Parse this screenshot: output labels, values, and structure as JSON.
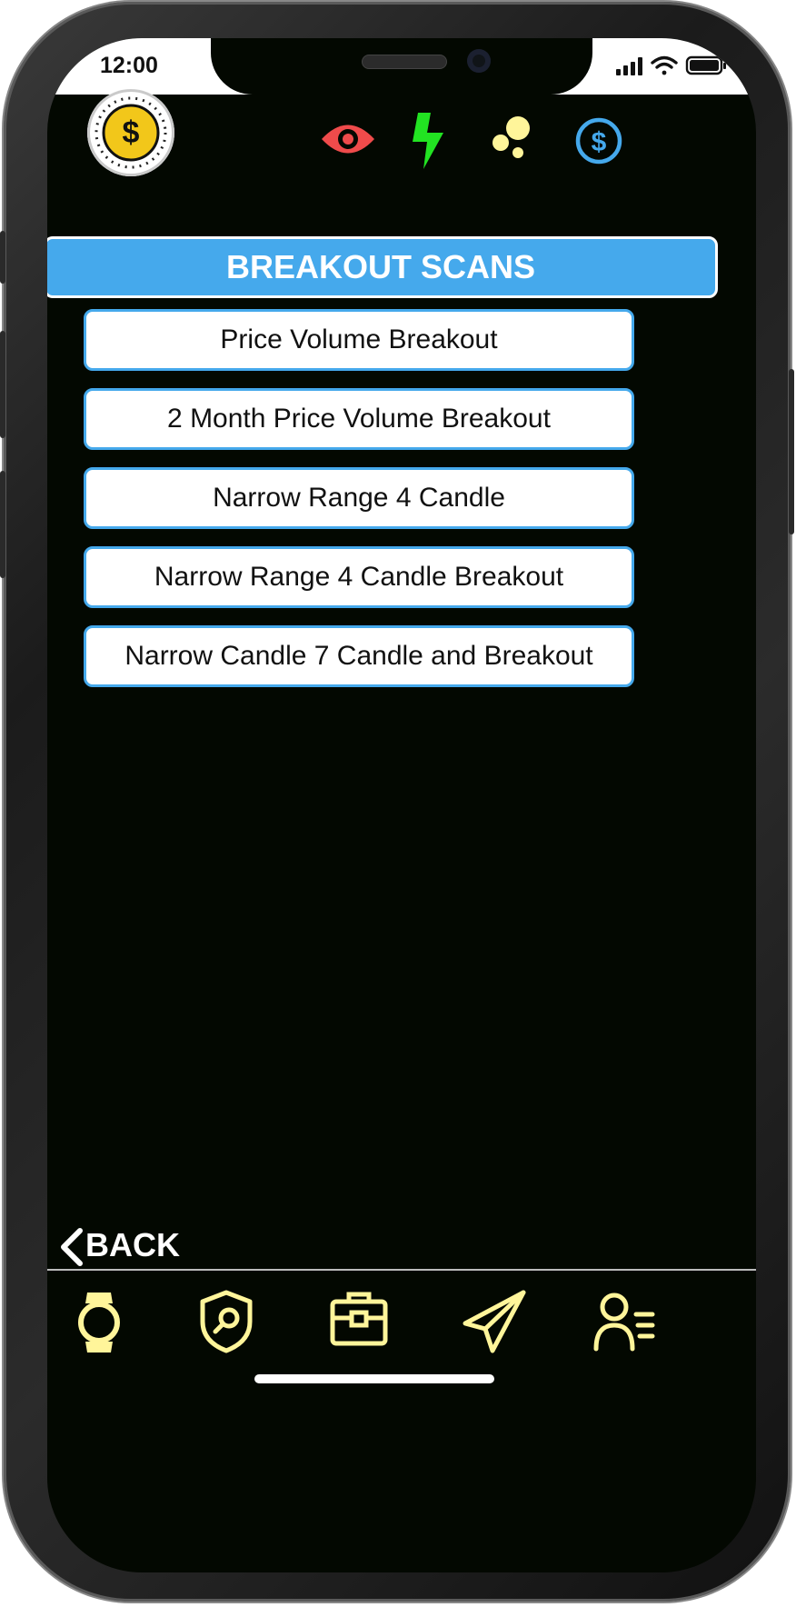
{
  "status_bar": {
    "time": "12:00"
  },
  "header": {
    "logo_icon": "dollar-coin-icon",
    "icons": [
      "eye-icon",
      "lightning-icon",
      "bubbles-icon",
      "dollar-circle-icon"
    ],
    "colors": {
      "eye": "#ef4b4b",
      "lightning": "#22e322",
      "bubbles": "#fff59a",
      "dollar": "#45a9ec"
    }
  },
  "section": {
    "title": "BREAKOUT SCANS"
  },
  "scans": [
    {
      "label": "Price Volume Breakout"
    },
    {
      "label": "2 Month Price Volume Breakout"
    },
    {
      "label": "Narrow Range 4 Candle"
    },
    {
      "label": "Narrow Range 4 Candle Breakout"
    },
    {
      "label": "Narrow Candle 7 Candle and Breakout"
    }
  ],
  "back": {
    "label": "BACK"
  },
  "tabbar": {
    "items": [
      "watch-icon",
      "shield-search-icon",
      "briefcase-icon",
      "paper-plane-icon",
      "user-list-icon"
    ],
    "color": "#fff59a"
  },
  "theme": {
    "accent": "#45a9ec",
    "background": "#030801"
  }
}
